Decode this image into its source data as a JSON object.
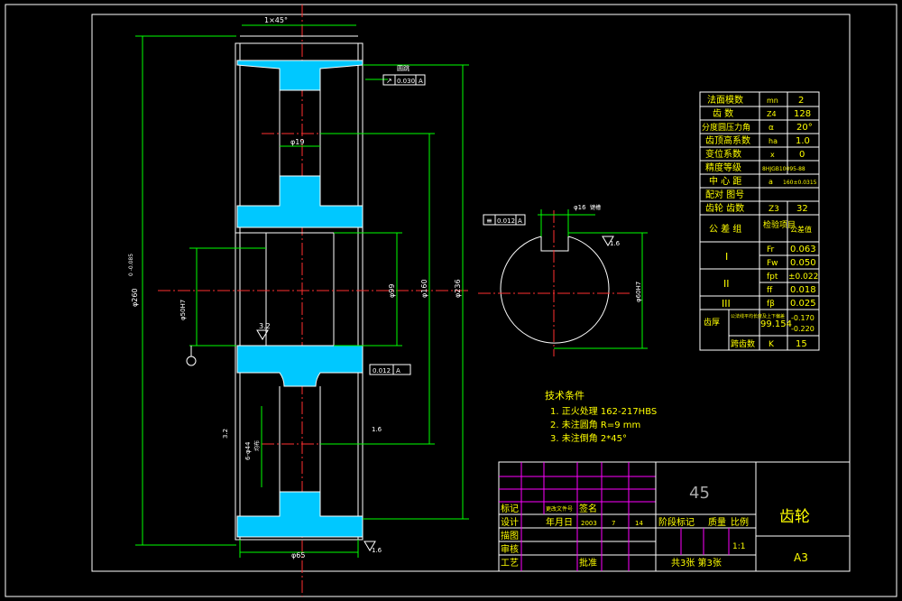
{
  "drawing": {
    "chamfer_top": "1×45°",
    "runout_label": "圆跳",
    "runout_tol": "0.030",
    "datum_a": "A",
    "dims": {
      "d260": "φ260",
      "d260_tol": "0\n-0.085",
      "d19": "φ19",
      "d99": "φ99",
      "d160": "φ160",
      "d236": "φ236",
      "d65": "φ65",
      "d50": "φ50H7",
      "bore_holes": "6-φ44",
      "bore_holes_note": "均布",
      "r32": "3.2",
      "r32b": "3.2",
      "r16": "1.6",
      "r16b": "1.6",
      "flat_tol": "0.012",
      "flat_datum": "A"
    }
  },
  "section": {
    "sym_tol": "0.012",
    "sym_datum": "A",
    "keyway": "φ16",
    "keyway_note": "键槽",
    "rough": "1.6",
    "bore": "φ60H7"
  },
  "tech": {
    "title": "技术条件",
    "items": [
      "1. 正火处理 162-217HBS",
      "2. 未注圆角 R=9  mm",
      "3. 未注倒角 2*45°"
    ]
  },
  "params": [
    [
      "法面模数",
      "mn",
      "2"
    ],
    [
      "齿 数",
      "Z4",
      "128"
    ],
    [
      "分度圆压力角",
      "α",
      "20°"
    ],
    [
      "齿顶高系数",
      "ha",
      "1.0"
    ],
    [
      "变位系数",
      "x",
      "0"
    ],
    [
      "精度等级",
      "8HJGB10095-88",
      ""
    ],
    [
      "中 心 距",
      "a",
      "160±0.0315"
    ],
    [
      "配对 图号",
      "",
      ""
    ],
    [
      "齿轮 齿数",
      "Z3",
      "32"
    ]
  ],
  "tol": {
    "group": "公 差 组",
    "check": "检验项目",
    "value": "公差值",
    "i": "I",
    "ii": "II",
    "iii": "III",
    "fr": "Fr",
    "fr_v": "0.063",
    "fw": "Fw",
    "fw_v": "0.050",
    "fpt": "fpt",
    "fpt_v": "±0.022",
    "ff": "ff",
    "ff_v": "0.018",
    "fb": "fβ",
    "fb_v": "0.025",
    "thick": "齿厚",
    "thick_note": "公法线平均长度及上下偏差",
    "thick_v": "99.154",
    "thick_up": "-0.170",
    "thick_dn": "-0.220",
    "k": "跨齿数",
    "k_sym": "K",
    "k_v": "15"
  },
  "title": {
    "material": "45",
    "name": "齿轮",
    "sheet": "A3",
    "scale": "1:1",
    "count": "共3张 第3张",
    "biaoji": "标记",
    "chuli": "更改文件号",
    "qianming": "签名",
    "sheji": "设计",
    "nianyueri": "年月日",
    "year": "2003",
    "m": "7",
    "d": "14",
    "jieduan": "阶段标记",
    "zhiliang": "质量",
    "bili": "比例",
    "miaotu": "描图",
    "shenhe": "审核",
    "gongyi": "工艺",
    "pizhun": "批准"
  }
}
